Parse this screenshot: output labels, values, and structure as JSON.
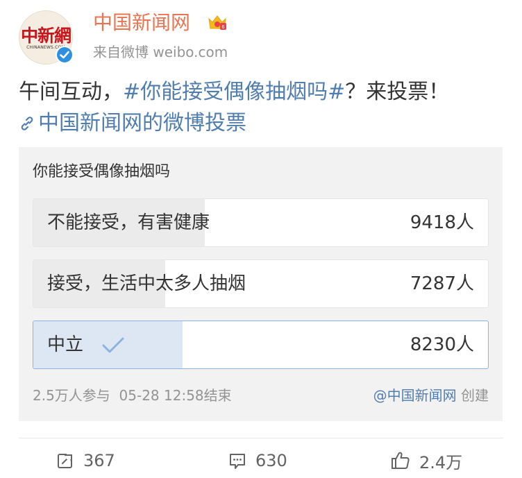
{
  "author": {
    "name": "中国新闻网",
    "avatar_logo": "中新網",
    "avatar_sub": "CHINANEWS.COM",
    "source": "来自微博 weibo.com",
    "verified_icon": "verified-check-icon",
    "vip_icon": "crown-icon"
  },
  "post": {
    "text_prefix": "午间互动，",
    "topic": "#你能接受偶像抽烟吗#",
    "text_suffix": "？来投票！",
    "link_text": "中国新闻网的微博投票"
  },
  "vote": {
    "title": "你能接受偶像抽烟吗",
    "options": [
      {
        "label": "不能接受，有害健康",
        "count": "9418人",
        "share": 0.377,
        "selected": false
      },
      {
        "label": "接受，生活中太多人抽烟",
        "count": "7287人",
        "share": 0.29,
        "selected": false
      },
      {
        "label": "中立",
        "count": "8230人",
        "share": 0.329,
        "selected": true
      }
    ],
    "participants": "2.5万人参与",
    "end_time": "05-28 12:58结束",
    "creator": "@中国新闻网",
    "creator_suffix": " 创建"
  },
  "actions": {
    "repost": "367",
    "comment": "630",
    "like": "2.4万"
  },
  "colors": {
    "accent_orange": "#eb7350",
    "link_blue": "#507daf",
    "selected_fill": "#dde7f3"
  }
}
